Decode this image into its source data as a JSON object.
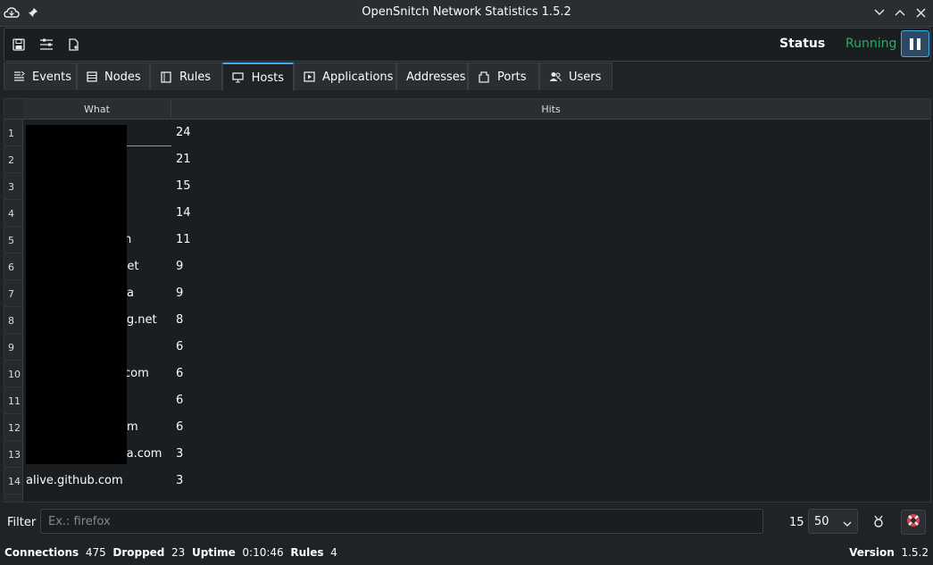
{
  "window": {
    "title": "OpenSnitch Network Statistics 1.5.2"
  },
  "toolbar": {
    "status_label": "Status",
    "status_value": "Running",
    "status_color": "#27ae60"
  },
  "tabs": [
    {
      "label": "Events",
      "icon": "events-list-icon"
    },
    {
      "label": "Nodes",
      "icon": "server-icon"
    },
    {
      "label": "Rules",
      "icon": "rules-icon"
    },
    {
      "label": "Hosts",
      "icon": "monitor-icon",
      "active": true
    },
    {
      "label": "Applications",
      "icon": "application-icon"
    },
    {
      "label": "Addresses",
      "icon": ""
    },
    {
      "label": "Ports",
      "icon": "port-icon"
    },
    {
      "label": "Users",
      "icon": "users-icon"
    }
  ],
  "table": {
    "columns": [
      "What",
      "Hits"
    ],
    "rows": [
      {
        "num": "1",
        "what": "",
        "hits": "24"
      },
      {
        "num": "2",
        "what": "",
        "hits": "21"
      },
      {
        "num": "3",
        "what": "",
        "hits": "15"
      },
      {
        "num": "4",
        "what": "",
        "hits": "14"
      },
      {
        "num": "5",
        "what": "n",
        "hits": "11"
      },
      {
        "num": "6",
        "what": ".net",
        "hits": "9"
      },
      {
        "num": "7",
        "what": "a",
        "hits": "9"
      },
      {
        "num": "8",
        "what": "ing.net",
        "hits": "8"
      },
      {
        "num": "9",
        "what": "",
        "hits": "6"
      },
      {
        "num": "10",
        "what": "com",
        "hits": "6"
      },
      {
        "num": "11",
        "what": "",
        "hits": "6"
      },
      {
        "num": "12",
        "what": "m",
        "hits": "6"
      },
      {
        "num": "13",
        "what": "la.com",
        "hits": "3"
      },
      {
        "num": "14",
        "what": "alive.github.com",
        "hits": "3"
      }
    ]
  },
  "filter": {
    "label": "Filter",
    "placeholder": "Ex.: firefox",
    "count": "15",
    "limit": "50"
  },
  "statusbar": {
    "connections_label": "Connections",
    "connections": "475",
    "dropped_label": "Dropped",
    "dropped": "23",
    "uptime_label": "Uptime",
    "uptime": "0:10:46",
    "rules_label": "Rules",
    "rules": "4",
    "version_label": "Version",
    "version": "1.5.2"
  },
  "accent_color": "#3daee9"
}
